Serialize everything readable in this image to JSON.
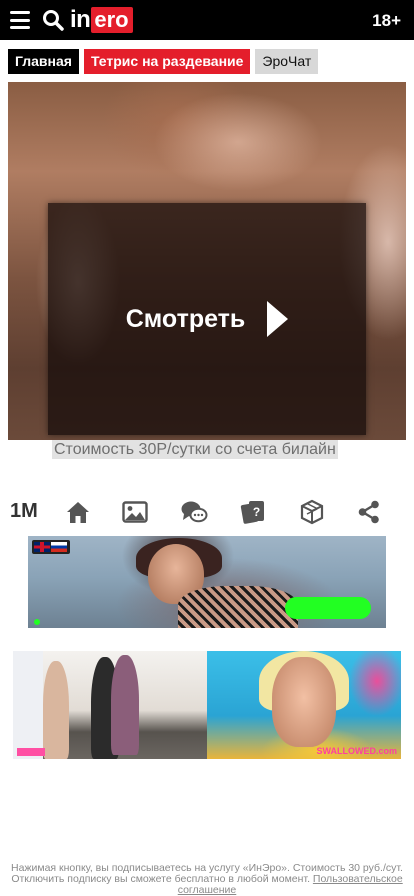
{
  "header": {
    "logo_in": "in",
    "logo_ero": "ero",
    "age_badge": "18+",
    "menu_icon": "hamburger-menu-icon",
    "search_icon": "search-icon"
  },
  "tabs": [
    {
      "label": "Главная"
    },
    {
      "label": "Тетрис на раздевание"
    },
    {
      "label": "ЭроЧат"
    }
  ],
  "video": {
    "watch_label": "Смотреть",
    "price_note": "Стоимость 30Р/сутки со счета билайн"
  },
  "actions": {
    "views": "1M",
    "icons": [
      "home-icon",
      "image-icon",
      "chat-icon",
      "cards-icon",
      "cube-icon",
      "share-icon"
    ]
  },
  "banner": {
    "flags": [
      "uk-flag",
      "ru-flag"
    ]
  },
  "thumbs": [
    {
      "tag": ""
    },
    {
      "tag": "SWALLOWED.com"
    }
  ],
  "footer": {
    "text": "Нажимая кнопку, вы подписываетесь на услугу «ИнЭро». Стоимость 30 руб./сут. Отключить подписку вы сможете бесплатно в любой момент.",
    "link": "Пользовательское соглашение"
  },
  "colors": {
    "brand_red": "#e41e2b",
    "header_bg": "#000000",
    "accent_green": "#22ff22",
    "icon_gray": "#555555"
  }
}
